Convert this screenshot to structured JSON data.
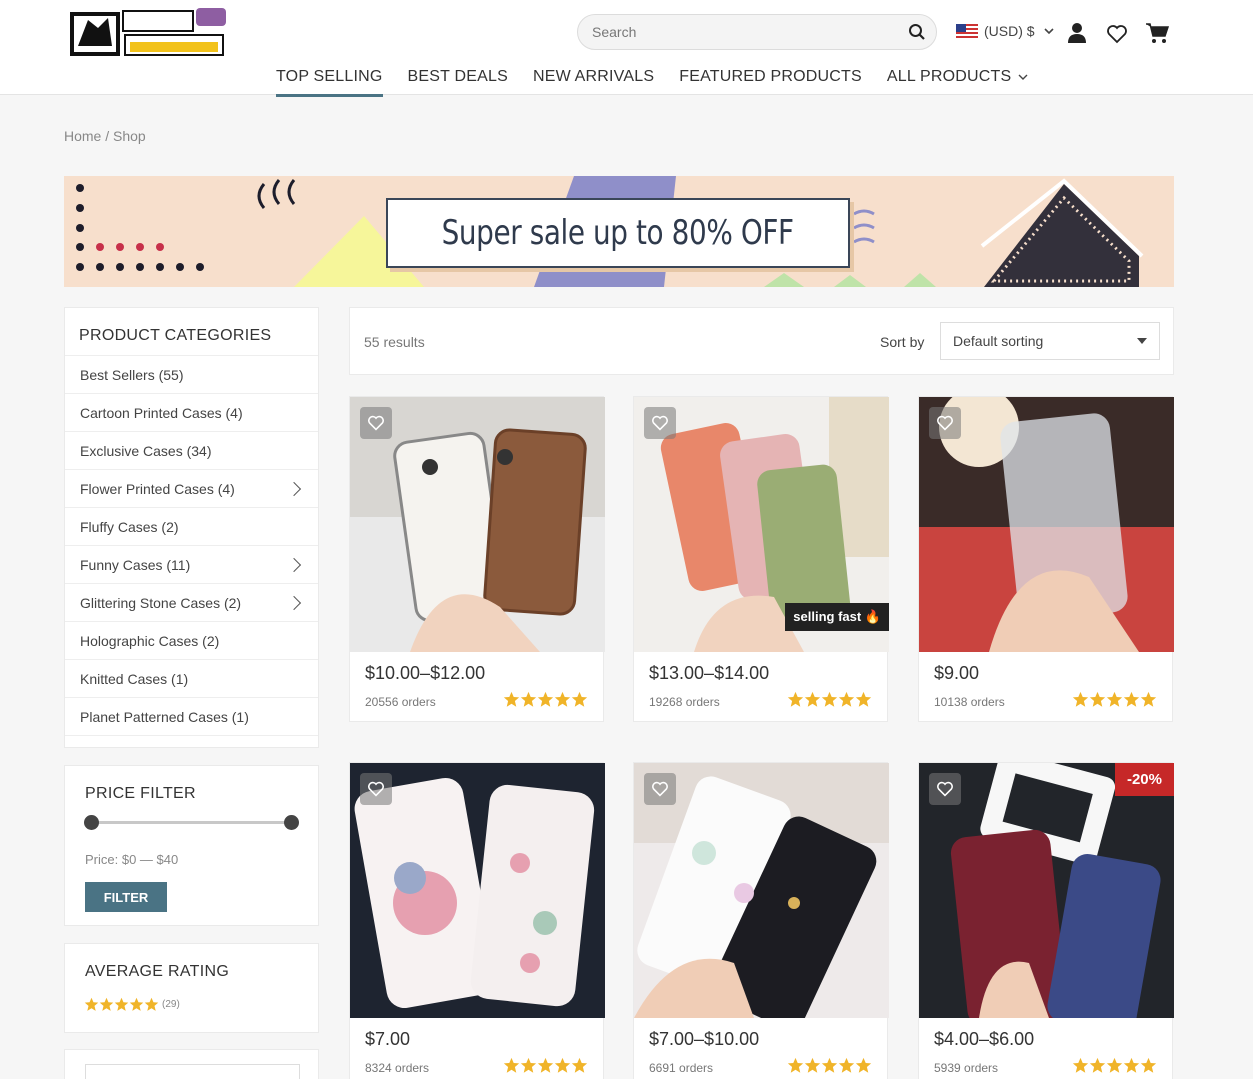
{
  "header": {
    "search_placeholder": "Search",
    "currency": "(USD) $"
  },
  "nav": {
    "items": [
      "TOP SELLING",
      "BEST DEALS",
      "NEW ARRIVALS",
      "FEATURED PRODUCTS",
      "ALL PRODUCTS"
    ]
  },
  "breadcrumb": "Home / Shop",
  "banner": {
    "text": "Super sale up to 80% OFF"
  },
  "categories": {
    "title": "PRODUCT CATEGORIES",
    "items": [
      {
        "label": "Best Sellers (55)",
        "has_children": false
      },
      {
        "label": "Cartoon Printed Cases (4)",
        "has_children": false
      },
      {
        "label": "Exclusive Cases (34)",
        "has_children": false
      },
      {
        "label": "Flower Printed Cases (4)",
        "has_children": true
      },
      {
        "label": "Fluffy Cases (2)",
        "has_children": false
      },
      {
        "label": "Funny Cases (11)",
        "has_children": true
      },
      {
        "label": "Glittering Stone Cases (2)",
        "has_children": true
      },
      {
        "label": "Holographic Cases (2)",
        "has_children": false
      },
      {
        "label": "Knitted Cases (1)",
        "has_children": false
      },
      {
        "label": "Planet Patterned Cases (1)",
        "has_children": false
      }
    ]
  },
  "price_filter": {
    "title": "PRICE FILTER",
    "price_label": "Price: $0 — $40",
    "button": "FILTER"
  },
  "rating": {
    "title": "AVERAGE RATING",
    "count": "(29)"
  },
  "toolbar": {
    "results": "55 results",
    "sort_label": "Sort by",
    "sort_value": "Default sorting"
  },
  "products": [
    {
      "price": "$10.00–$12.00",
      "orders": "20556 orders",
      "badge": ""
    },
    {
      "price": "$13.00–$14.00",
      "orders": "19268 orders",
      "badge": "selling fast 🔥"
    },
    {
      "price": "$9.00",
      "orders": "10138 orders",
      "badge": ""
    },
    {
      "price": "$7.00",
      "orders": "8324 orders",
      "badge": ""
    },
    {
      "price": "$7.00–$10.00",
      "orders": "6691 orders",
      "badge": ""
    },
    {
      "price": "$4.00–$6.00",
      "orders": "5939 orders",
      "badge": "-20%"
    }
  ],
  "colors": {
    "accent": "#4a7384",
    "star": "#f0b429",
    "sale": "#c62828"
  }
}
